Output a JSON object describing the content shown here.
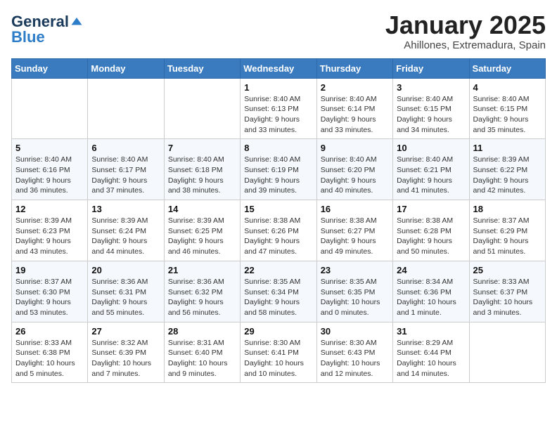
{
  "logo": {
    "line1": "General",
    "line2": "Blue"
  },
  "header": {
    "month": "January 2025",
    "location": "Ahillones, Extremadura, Spain"
  },
  "weekdays": [
    "Sunday",
    "Monday",
    "Tuesday",
    "Wednesday",
    "Thursday",
    "Friday",
    "Saturday"
  ],
  "weeks": [
    [
      {
        "day": "",
        "info": ""
      },
      {
        "day": "",
        "info": ""
      },
      {
        "day": "",
        "info": ""
      },
      {
        "day": "1",
        "info": "Sunrise: 8:40 AM\nSunset: 6:13 PM\nDaylight: 9 hours\nand 33 minutes."
      },
      {
        "day": "2",
        "info": "Sunrise: 8:40 AM\nSunset: 6:14 PM\nDaylight: 9 hours\nand 33 minutes."
      },
      {
        "day": "3",
        "info": "Sunrise: 8:40 AM\nSunset: 6:15 PM\nDaylight: 9 hours\nand 34 minutes."
      },
      {
        "day": "4",
        "info": "Sunrise: 8:40 AM\nSunset: 6:15 PM\nDaylight: 9 hours\nand 35 minutes."
      }
    ],
    [
      {
        "day": "5",
        "info": "Sunrise: 8:40 AM\nSunset: 6:16 PM\nDaylight: 9 hours\nand 36 minutes."
      },
      {
        "day": "6",
        "info": "Sunrise: 8:40 AM\nSunset: 6:17 PM\nDaylight: 9 hours\nand 37 minutes."
      },
      {
        "day": "7",
        "info": "Sunrise: 8:40 AM\nSunset: 6:18 PM\nDaylight: 9 hours\nand 38 minutes."
      },
      {
        "day": "8",
        "info": "Sunrise: 8:40 AM\nSunset: 6:19 PM\nDaylight: 9 hours\nand 39 minutes."
      },
      {
        "day": "9",
        "info": "Sunrise: 8:40 AM\nSunset: 6:20 PM\nDaylight: 9 hours\nand 40 minutes."
      },
      {
        "day": "10",
        "info": "Sunrise: 8:40 AM\nSunset: 6:21 PM\nDaylight: 9 hours\nand 41 minutes."
      },
      {
        "day": "11",
        "info": "Sunrise: 8:39 AM\nSunset: 6:22 PM\nDaylight: 9 hours\nand 42 minutes."
      }
    ],
    [
      {
        "day": "12",
        "info": "Sunrise: 8:39 AM\nSunset: 6:23 PM\nDaylight: 9 hours\nand 43 minutes."
      },
      {
        "day": "13",
        "info": "Sunrise: 8:39 AM\nSunset: 6:24 PM\nDaylight: 9 hours\nand 44 minutes."
      },
      {
        "day": "14",
        "info": "Sunrise: 8:39 AM\nSunset: 6:25 PM\nDaylight: 9 hours\nand 46 minutes."
      },
      {
        "day": "15",
        "info": "Sunrise: 8:38 AM\nSunset: 6:26 PM\nDaylight: 9 hours\nand 47 minutes."
      },
      {
        "day": "16",
        "info": "Sunrise: 8:38 AM\nSunset: 6:27 PM\nDaylight: 9 hours\nand 49 minutes."
      },
      {
        "day": "17",
        "info": "Sunrise: 8:38 AM\nSunset: 6:28 PM\nDaylight: 9 hours\nand 50 minutes."
      },
      {
        "day": "18",
        "info": "Sunrise: 8:37 AM\nSunset: 6:29 PM\nDaylight: 9 hours\nand 51 minutes."
      }
    ],
    [
      {
        "day": "19",
        "info": "Sunrise: 8:37 AM\nSunset: 6:30 PM\nDaylight: 9 hours\nand 53 minutes."
      },
      {
        "day": "20",
        "info": "Sunrise: 8:36 AM\nSunset: 6:31 PM\nDaylight: 9 hours\nand 55 minutes."
      },
      {
        "day": "21",
        "info": "Sunrise: 8:36 AM\nSunset: 6:32 PM\nDaylight: 9 hours\nand 56 minutes."
      },
      {
        "day": "22",
        "info": "Sunrise: 8:35 AM\nSunset: 6:34 PM\nDaylight: 9 hours\nand 58 minutes."
      },
      {
        "day": "23",
        "info": "Sunrise: 8:35 AM\nSunset: 6:35 PM\nDaylight: 10 hours\nand 0 minutes."
      },
      {
        "day": "24",
        "info": "Sunrise: 8:34 AM\nSunset: 6:36 PM\nDaylight: 10 hours\nand 1 minute."
      },
      {
        "day": "25",
        "info": "Sunrise: 8:33 AM\nSunset: 6:37 PM\nDaylight: 10 hours\nand 3 minutes."
      }
    ],
    [
      {
        "day": "26",
        "info": "Sunrise: 8:33 AM\nSunset: 6:38 PM\nDaylight: 10 hours\nand 5 minutes."
      },
      {
        "day": "27",
        "info": "Sunrise: 8:32 AM\nSunset: 6:39 PM\nDaylight: 10 hours\nand 7 minutes."
      },
      {
        "day": "28",
        "info": "Sunrise: 8:31 AM\nSunset: 6:40 PM\nDaylight: 10 hours\nand 9 minutes."
      },
      {
        "day": "29",
        "info": "Sunrise: 8:30 AM\nSunset: 6:41 PM\nDaylight: 10 hours\nand 10 minutes."
      },
      {
        "day": "30",
        "info": "Sunrise: 8:30 AM\nSunset: 6:43 PM\nDaylight: 10 hours\nand 12 minutes."
      },
      {
        "day": "31",
        "info": "Sunrise: 8:29 AM\nSunset: 6:44 PM\nDaylight: 10 hours\nand 14 minutes."
      },
      {
        "day": "",
        "info": ""
      }
    ]
  ]
}
